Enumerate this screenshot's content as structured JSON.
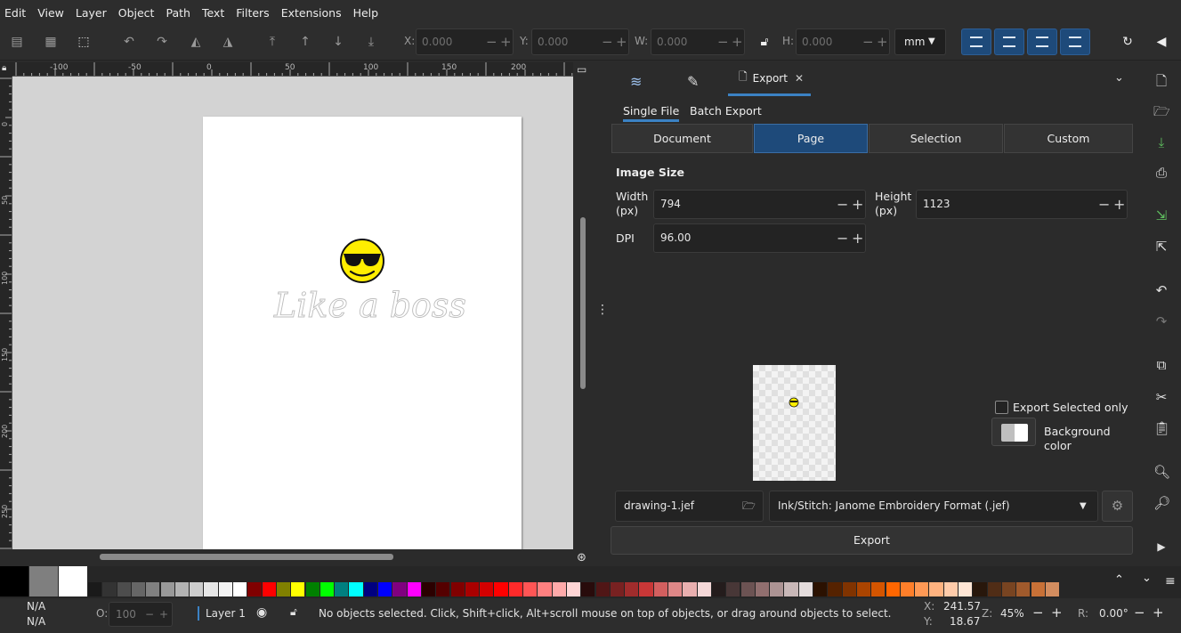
{
  "menu": [
    "Edit",
    "View",
    "Layer",
    "Object",
    "Path",
    "Text",
    "Filters",
    "Extensions",
    "Help"
  ],
  "toolbar": {
    "x_label": "X:",
    "x_value": "0.000",
    "y_label": "Y:",
    "y_value": "0.000",
    "w_label": "W:",
    "w_value": "0.000",
    "h_label": "H:",
    "h_value": "0.000",
    "unit": "mm"
  },
  "ruler": {
    "top_labels": [
      "-100",
      "-50",
      "0",
      "50",
      "100",
      "150",
      "200"
    ],
    "left_labels": [
      "0",
      "50",
      "100",
      "150",
      "200",
      "250"
    ]
  },
  "canvas": {
    "artwork_text": "Like a boss"
  },
  "dock": {
    "tab_export_label": "Export",
    "tab_close": "✕",
    "subtabs": [
      "Single File",
      "Batch Export"
    ],
    "areas": [
      "Document",
      "Page",
      "Selection",
      "Custom"
    ],
    "active_area": "Page",
    "image_size_label": "Image Size",
    "width_label": "Width\n(px)",
    "width_value": "794",
    "height_label": "Height\n(px)",
    "height_value": "1123",
    "dpi_label": "DPI",
    "dpi_value": "96.00",
    "export_selected_label": "Export Selected only",
    "background_color_label": "Background color",
    "filename": "drawing-1.jef",
    "format": "Ink/Stitch: Janome Embroidery Format (.jef)",
    "export_button": "Export"
  },
  "status": {
    "fill_label": "N/A",
    "stroke_label": "N/A",
    "opacity_label": "O:",
    "opacity_value": "100",
    "layer_name": "Layer 1",
    "message": "No objects selected. Click, Shift+click, Alt+scroll mouse on top of objects, or drag around objects to select.",
    "cursor_x_label": "X:",
    "cursor_x": "241.57",
    "cursor_y_label": "Y:",
    "cursor_y": "18.67",
    "zoom_label": "Z:",
    "zoom": "45%",
    "rotation_label": "R:",
    "rotation": "0.00°"
  },
  "palette_colors": [
    "#000000",
    "#7f7f7f",
    "#ffffff",
    "#1a1a1a",
    "#333333",
    "#4d4d4d",
    "#666666",
    "#808080",
    "#999999",
    "#b3b3b3",
    "#cccccc",
    "#e6e6e6",
    "#f2f2f2",
    "#ffffff",
    "#800000",
    "#ff0000",
    "#808000",
    "#ffff00",
    "#008000",
    "#00ff00",
    "#008080",
    "#00ffff",
    "#000080",
    "#0000ff",
    "#800080",
    "#ff00ff",
    "#2b0000",
    "#550000",
    "#800000",
    "#aa0000",
    "#d40000",
    "#ff0000",
    "#ff2a2a",
    "#ff5555",
    "#ff8080",
    "#ffaaaa",
    "#ffd5d5",
    "#280b0b",
    "#501616",
    "#782121",
    "#a02c2c",
    "#c83737",
    "#d35f5f",
    "#de8787",
    "#e9afaf",
    "#f4d7d7",
    "#241c1c",
    "#483737",
    "#6c5353",
    "#916f6f",
    "#ac9393",
    "#c8b7b7",
    "#e3dbdb",
    "#2b1100",
    "#552200",
    "#803300",
    "#aa4400",
    "#d45500",
    "#ff6600",
    "#ff7f2a",
    "#ff9955",
    "#ffb380",
    "#ffccaa",
    "#ffe6d5",
    "#28170b",
    "#502d16",
    "#784421",
    "#a05a2c",
    "#c87137",
    "#d38d5f"
  ]
}
